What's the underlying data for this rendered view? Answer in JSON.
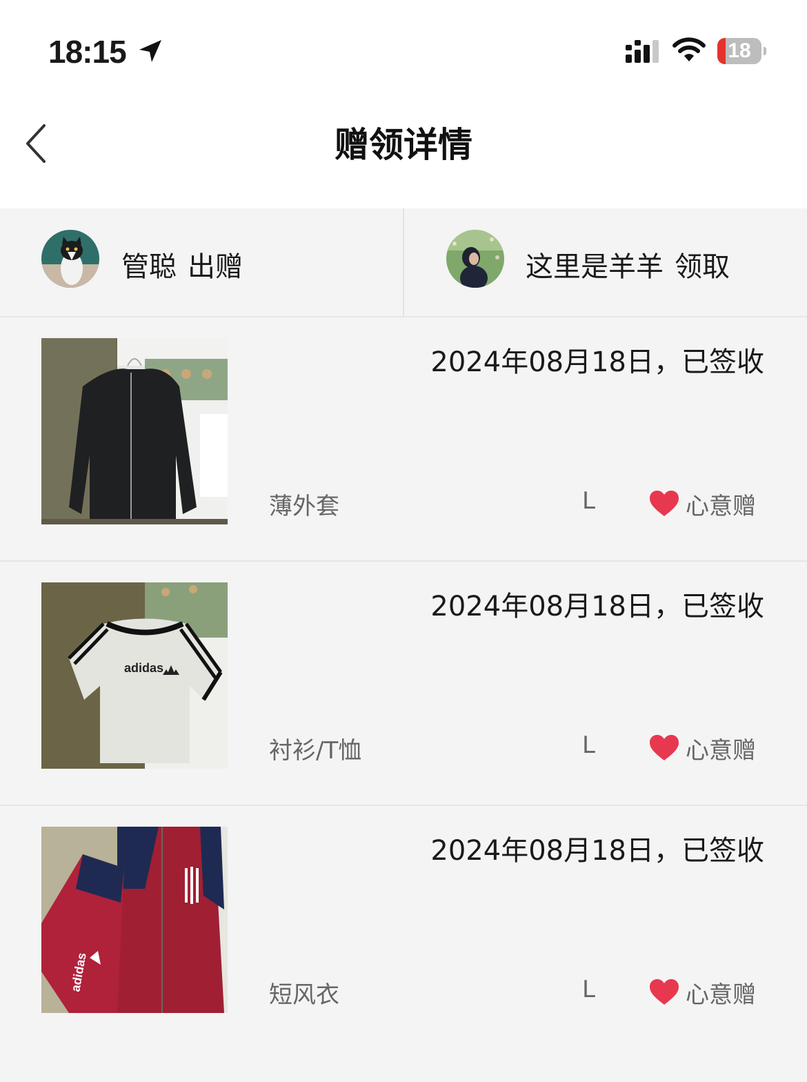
{
  "status_bar": {
    "time": "18:15",
    "battery_level": "18",
    "battery_fraction": 0.18,
    "icons": [
      "location-arrow-icon",
      "signal-icon",
      "wifi-icon",
      "battery-icon"
    ]
  },
  "nav": {
    "title": "赠领详情",
    "back_icon": "chevron-left-icon"
  },
  "giver": {
    "name": "管聪",
    "action": "出赠"
  },
  "receiver": {
    "name": "这里是羊羊",
    "action": "领取"
  },
  "colors": {
    "heart": "#e8384f",
    "battery_low": "#e5322d",
    "background": "#f4f4f4"
  },
  "items": [
    {
      "date_status": "2024年08月18日，已签收",
      "category": "薄外套",
      "size": "L",
      "tag": "心意赠",
      "image": "black-zip-jacket-photo"
    },
    {
      "date_status": "2024年08月18日，已签收",
      "category": "衬衫/T恤",
      "size": "L",
      "tag": "心意赠",
      "image": "adidas-white-tshirt-photo"
    },
    {
      "date_status": "2024年08月18日，已签收",
      "category": "短风衣",
      "size": "L",
      "tag": "心意赠",
      "image": "red-navy-windbreaker-photo"
    }
  ]
}
